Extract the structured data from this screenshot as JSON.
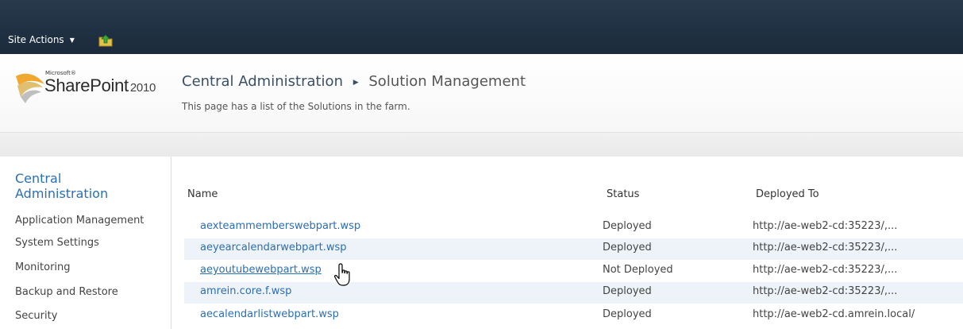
{
  "ribbon": {
    "site_actions_label": "Site Actions",
    "nav_up_icon": "navigate-up-folder-icon"
  },
  "header": {
    "logo": {
      "microsoft": "Microsoft®",
      "product": "SharePoint",
      "year": "2010"
    },
    "breadcrumb": {
      "root": "Central Administration",
      "current": "Solution Management"
    },
    "description": "This page has a list of the Solutions in the farm."
  },
  "quicklaunch": {
    "heading": "Central Administration",
    "items": [
      {
        "label": "Application Management"
      },
      {
        "label": "System Settings"
      },
      {
        "label": "Monitoring"
      },
      {
        "label": "Backup and Restore"
      },
      {
        "label": "Security"
      }
    ]
  },
  "table": {
    "columns": {
      "name": "Name",
      "status": "Status",
      "deployed_to": "Deployed To"
    },
    "rows": [
      {
        "name": "aexteammemberswebpart.wsp",
        "status": "Deployed",
        "deployed_to": "http://ae-web2-cd:35223/,..."
      },
      {
        "name": "aeyearcalendarwebpart.wsp",
        "status": "Deployed",
        "deployed_to": "http://ae-web2-cd:35223/,..."
      },
      {
        "name": "aeyoutubewebpart.wsp",
        "status": "Not Deployed",
        "deployed_to": "http://ae-web2-cd:35223/,..."
      },
      {
        "name": "amrein.core.f.wsp",
        "status": "Deployed",
        "deployed_to": "http://ae-web2-cd:35223/,..."
      },
      {
        "name": "aecalendarlistwebpart.wsp",
        "status": "Deployed",
        "deployed_to": "http://ae-web2-cd.amrein.local/"
      }
    ]
  },
  "colors": {
    "ribbon_bg": "#1f3042",
    "link": "#2a6fb6",
    "alt_row": "#eef3f9"
  }
}
